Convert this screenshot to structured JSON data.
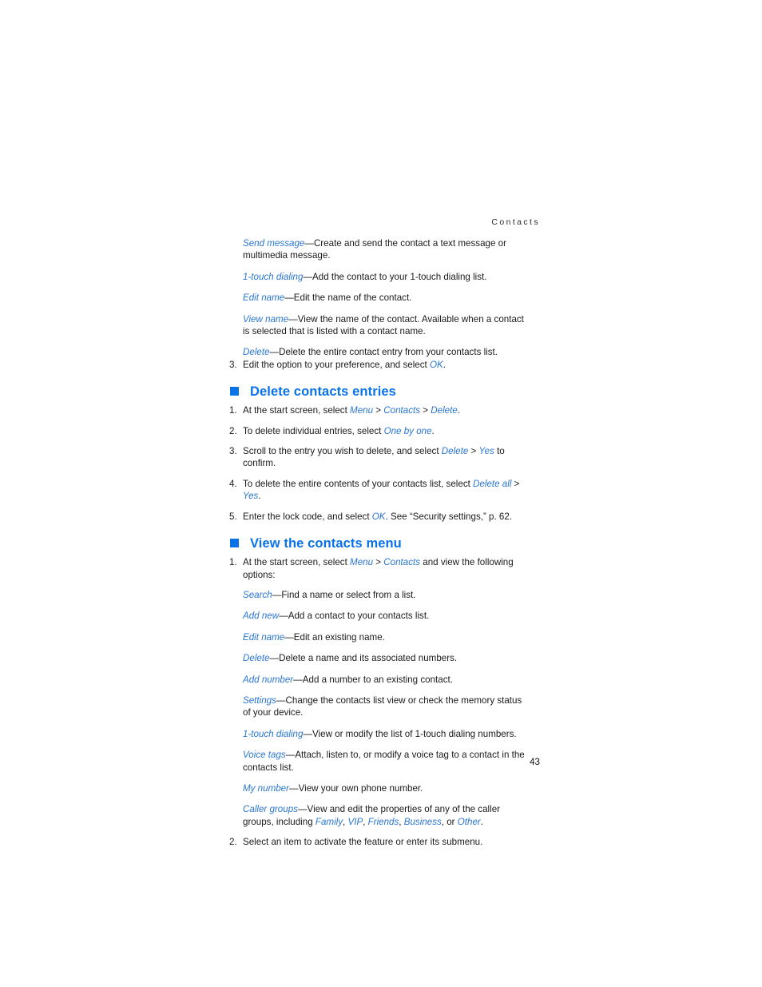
{
  "page": {
    "running_head": "Contacts",
    "folio": "43",
    "accent_heading_color": "#0a72e8",
    "accent_term_color": "#2a76d2",
    "body_color": "#1a1a1a"
  },
  "top_options": [
    {
      "term": "Send message",
      "dash": "—",
      "desc": "Create and send the contact a text message or multimedia message."
    },
    {
      "term": "1-touch dialing",
      "dash": "—",
      "desc": "Add the contact to your 1-touch dialing list."
    },
    {
      "term": "Edit name",
      "dash": "—",
      "desc": "Edit the name of the contact."
    },
    {
      "term": "View name",
      "dash": "—",
      "desc": "View the name of the contact. Available when a contact is selected that is listed with a contact name."
    },
    {
      "term": "Delete",
      "dash": "—",
      "desc": "Delete the entire contact entry from your contacts list."
    }
  ],
  "continued_step": {
    "num": "3.",
    "pre": "Edit the option to your preference, and select ",
    "term": "OK",
    "post": "."
  },
  "section_delete": {
    "heading": "Delete contacts entries",
    "steps": [
      {
        "num": "1.",
        "pre": "At the start screen, select ",
        "term1": "Menu",
        "sep1": " > ",
        "term2": "Contacts",
        "sep2": " > ",
        "term3": "Delete",
        "post": "."
      },
      {
        "num": "2.",
        "pre": "To delete individual entries, select ",
        "term1": "One by one",
        "post": "."
      },
      {
        "num": "3.",
        "pre": "Scroll to the entry you wish to delete, and select ",
        "term1": "Delete",
        "sep1": " > ",
        "term2": "Yes",
        "post": " to confirm."
      },
      {
        "num": "4.",
        "pre": "To delete the entire contents of your contacts list, select ",
        "term1": "Delete all",
        "sep1": " > ",
        "term2": "Yes",
        "post": "."
      },
      {
        "num": "5.",
        "pre": "Enter the lock code, and select ",
        "term1": "OK",
        "post": ". See “Security settings,” p. 62."
      }
    ]
  },
  "section_view": {
    "heading": "View the contacts menu",
    "step1": {
      "num": "1.",
      "pre": "At the start screen, select ",
      "term1": "Menu",
      "sep1": " > ",
      "term2": "Contacts",
      "post": " and view the following options:"
    },
    "options": [
      {
        "term": "Search",
        "dash": "—",
        "desc": "Find a name or select from a list."
      },
      {
        "term": "Add new",
        "dash": "—",
        "desc": "Add a contact to your contacts list."
      },
      {
        "term": "Edit name",
        "dash": "—",
        "desc": "Edit an existing name."
      },
      {
        "term": "Delete",
        "dash": "—",
        "desc": "Delete a name and its associated numbers."
      },
      {
        "term": "Add number",
        "dash": "—",
        "desc": "Add a number to an existing contact."
      },
      {
        "term": "Settings",
        "dash": "—",
        "desc": "Change the contacts list view or check the memory status of your device."
      },
      {
        "term": "1-touch dialing",
        "dash": "—",
        "desc": "View or modify the list of 1-touch dialing numbers."
      },
      {
        "term": "Voice tags",
        "dash": "—",
        "desc": "Attach, listen to, or modify a voice tag to a contact in the contacts list."
      },
      {
        "term": "My number",
        "dash": "—",
        "desc": "View your own phone number."
      }
    ],
    "caller_groups": {
      "term": "Caller groups",
      "dash": "—",
      "pre": "View and edit the properties of any of the caller groups, including ",
      "g1": "Family",
      "c1": ", ",
      "g2": "VIP",
      "c2": ", ",
      "g3": "Friends",
      "c3": ", ",
      "g4": "Business",
      "c4": ", or ",
      "g5": "Other",
      "post": "."
    },
    "step2": {
      "num": "2.",
      "text": "Select an item to activate the feature or enter its submenu."
    }
  }
}
